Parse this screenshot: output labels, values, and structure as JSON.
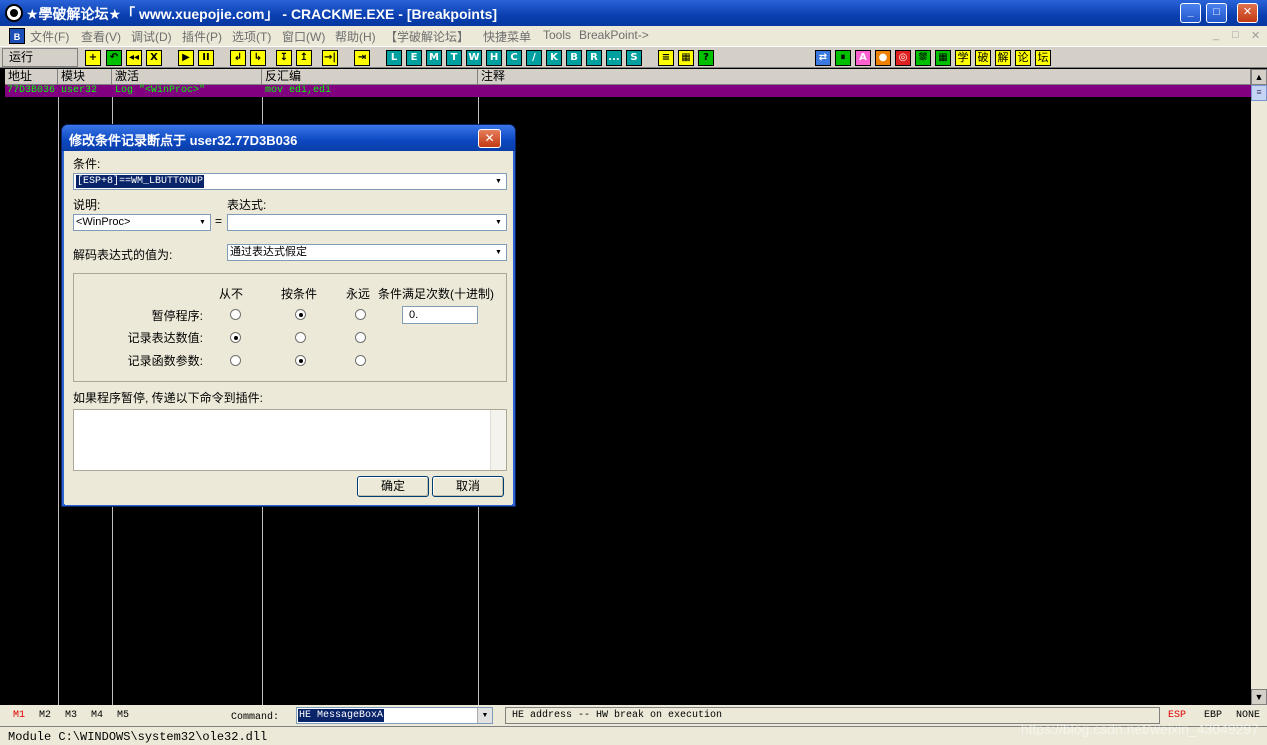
{
  "window": {
    "title": "★學破解论坛★「 www.xuepojie.com」 - CRACKME.EXE - [Breakpoints]",
    "controls": {
      "minimize": "_",
      "maximize": "□",
      "close": "✕"
    }
  },
  "menu": {
    "sys_icon": "B",
    "items": [
      "文件(F)",
      "查看(V)",
      "调试(D)",
      "插件(P)",
      "选项(T)",
      "窗口(W)",
      "帮助(H)",
      "【学破解论坛】",
      "快捷菜单",
      "Tools",
      "BreakPoint->"
    ],
    "child_controls": [
      "_",
      "□",
      "✕"
    ]
  },
  "toolbar": {
    "run_status": "运行",
    "buttons": [
      "+",
      "↶",
      "◂◂",
      "X",
      "▶",
      "II",
      "↲",
      "↳",
      "↧",
      "↥",
      "→|",
      "⇥",
      "L",
      "E",
      "M",
      "T",
      "W",
      "H",
      "C",
      "/",
      "K",
      "B",
      "R",
      "...",
      "S",
      "≡",
      "▦",
      "?"
    ],
    "right_buttons": [
      "⇄",
      "⏸",
      "A",
      "●",
      "◎",
      "⛆",
      "▦",
      "学",
      "破",
      "解",
      "论",
      "坛"
    ]
  },
  "grid": {
    "columns": [
      "地址",
      "模块",
      "激活",
      "反汇编",
      "注释"
    ],
    "rows": [
      {
        "address": "77D3B036",
        "module": "user32",
        "active": "Log \"<WinProc>\"",
        "disasm": "mov edi,edi",
        "comment": ""
      }
    ]
  },
  "dialog": {
    "title": "修改条件记录断点于 user32.77D3B036",
    "close": "✕",
    "condition_label": "条件:",
    "condition_value": "[ESP+8]==WM_LBUTTONUP",
    "explain_label": "说明:",
    "explain_value": "<WinProc>",
    "equals": "=",
    "expression_label": "表达式:",
    "expression_value": "",
    "decode_label": "解码表达式的值为:",
    "decode_value": "通过表达式假定",
    "options_headers": [
      "从不",
      "按条件",
      "永远",
      "条件满足次数(十进制)"
    ],
    "options_rows": [
      {
        "label": "暂停程序:",
        "selected": "按条件"
      },
      {
        "label": "记录表达数值:",
        "selected": "从不"
      },
      {
        "label": "记录函数参数:",
        "selected": "按条件"
      }
    ],
    "count_value": "0.",
    "plugin_label": "如果程序暂停, 传递以下命令到插件:",
    "plugin_commands": "",
    "ok_label": "确定",
    "cancel_label": "取消"
  },
  "command_bar": {
    "memory_tabs": [
      "M1",
      "M2",
      "M3",
      "M4",
      "M5"
    ],
    "command_label": "Command:",
    "command_value": "HE MessageBoxA",
    "hint": "HE address -- HW break on execution",
    "registers": [
      "ESP",
      "EBP",
      "NONE"
    ]
  },
  "status": {
    "text": "Module C:\\WINDOWS\\system32\\ole32.dll",
    "watermark": "https://blog.csdn.net/weixin_43049297"
  },
  "colors": {
    "grid_background": "#000000",
    "breakpoint_row": "#800080",
    "grid_text": "#00ff00",
    "active_memory_tab": "#e00000"
  }
}
